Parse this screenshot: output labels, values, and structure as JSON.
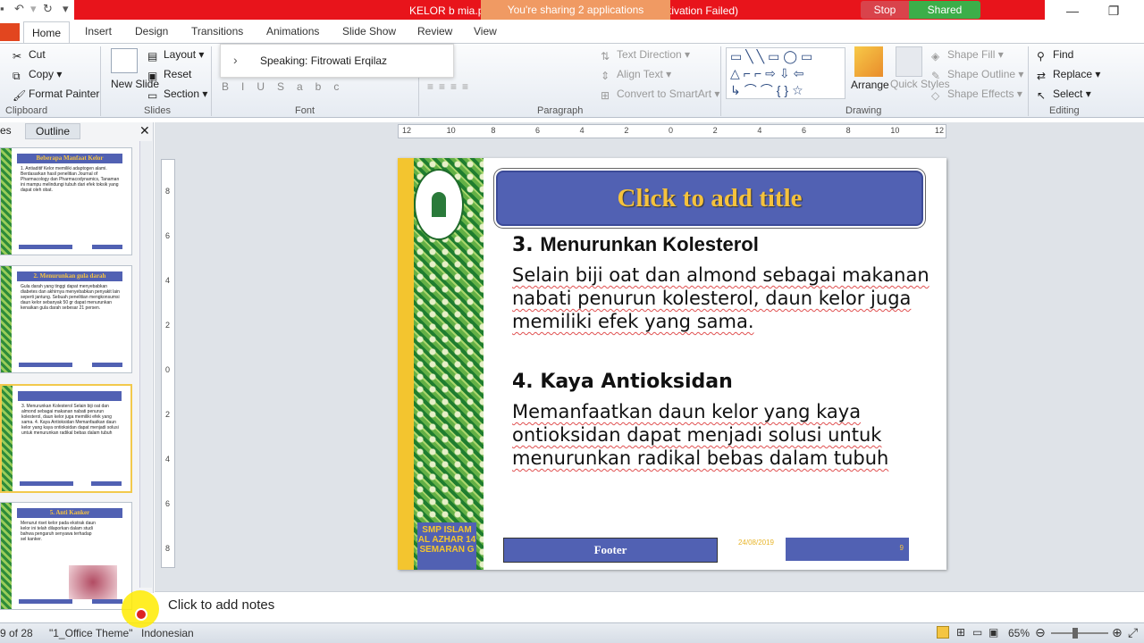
{
  "window": {
    "title": "KELOR b mia.p",
    "title_suffix": "tivation Failed)",
    "share_notice": "You're sharing 2 applications",
    "stop_label": "Stop",
    "shared_label": "Shared",
    "minimize_glyph": "—",
    "restore_glyph": "❐"
  },
  "tabs": [
    "Home",
    "Insert",
    "Design",
    "Transitions",
    "Animations",
    "Slide Show",
    "Review",
    "View"
  ],
  "speaking": {
    "label": "Speaking: Fitrowati Erqilaz"
  },
  "ribbon": {
    "clipboard": {
      "cut": "Cut",
      "copy": "Copy",
      "format_painter": "Format Painter",
      "label": "Clipboard"
    },
    "slides": {
      "new_slide": "New Slide",
      "layout": "Layout",
      "reset": "Reset",
      "section": "Section",
      "label": "Slides"
    },
    "font": {
      "label": "Font"
    },
    "paragraph": {
      "text_direction": "Text Direction",
      "align_text": "Align Text",
      "convert_smartart": "Convert to SmartArt",
      "label": "Paragraph"
    },
    "drawing": {
      "arrange": "Arrange",
      "quick_styles": "Quick Styles",
      "shape_fill": "Shape Fill",
      "shape_outline": "Shape Outline",
      "shape_effects": "Shape Effects",
      "label": "Drawing"
    },
    "editing": {
      "find": "Find",
      "replace": "Replace",
      "select": "Select",
      "label": "Editing"
    }
  },
  "panel": {
    "tab_slides": "es",
    "tab_outline": "Outline",
    "thumbs": [
      {
        "title": "Beberapa Manfaat Kelor",
        "text": "1. Antiaditif Kelor memiliki adaptogen alami. Berdasarkan hasil penelitian Journal of Pharmacology dan Pharmacodynamics, Tanaman ini mampu melindungi tubuh dari efek toksik yang dapat oleh obat."
      },
      {
        "title": "2. Menurunkan gula darah",
        "text": "Gula darah yang tinggi dapat menyebabkan diabetes dan akhirnya menyebabkan penyakit lain seperti jantung. Sebuah penelitian mengkonsumsi daun kelor sebanyak 50 gr dapat menurunkan kenaikan gula darah sebesar 21 persen."
      },
      {
        "title": "",
        "text": "3. Menurunkan Kolesterol  Selain biji oat dan almond sebagai makanan nabati penurun kolesterol, daun kelor juga memiliki efek yang sama.  4. Kaya Antioksidan  Memanfaatkan daun kelor yang kaya ontioksidan dapat menjadi solusi untuk menurunkan radikal bebas dalam tubuh"
      },
      {
        "title": "5. Anti Kanker",
        "text": "Menurut riset kelor pada ekstrak daun kelor ini telah dilaporkan dalam studi bahwa pengaruh senyawa terhadap sel kanker."
      }
    ]
  },
  "ruler": {
    "h_ticks": [
      "12",
      "10",
      "8",
      "6",
      "4",
      "2",
      "0",
      "2",
      "4",
      "6",
      "8",
      "10",
      "12"
    ],
    "v_ticks": [
      "8",
      "6",
      "4",
      "2",
      "0",
      "2",
      "4",
      "6",
      "8"
    ]
  },
  "slide": {
    "title_placeholder": "Click to add title",
    "h1_num": "3.",
    "h1": "Menurunkan Kolesterol",
    "p1": "Selain biji oat dan almond sebagai makanan nabati penurun kolesterol, daun kelor juga memiliki efek yang sama.",
    "h2": "4. Kaya Antioksidan",
    "p2": "Memanfaatkan daun kelor yang kaya ontioksidan dapat menjadi solusi untuk menurunkan radikal bebas dalam tubuh",
    "school": "SMP ISLAM AL AZHAR 14 SEMARAN G",
    "footer": "Footer",
    "date": "24/08/2019",
    "number": "9"
  },
  "notes": {
    "placeholder": "Click to add notes"
  },
  "status": {
    "slide_count": "9 of 28",
    "theme": "\"1_Office Theme\"",
    "language": "Indonesian",
    "zoom": "65%"
  }
}
